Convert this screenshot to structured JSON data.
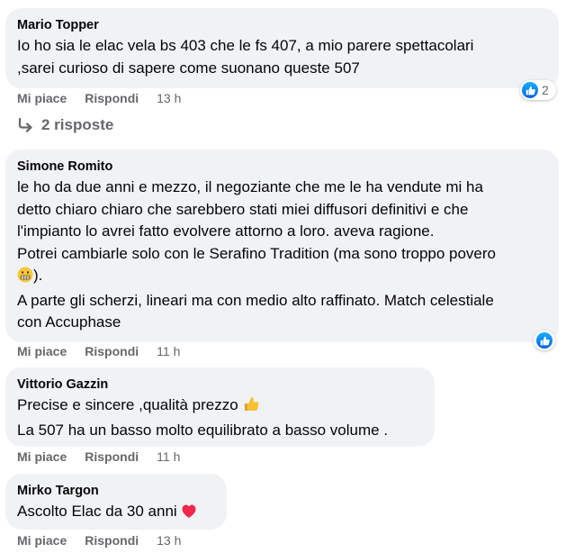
{
  "comments": [
    {
      "author": "Mario Topper",
      "lines": [
        "Io ho sia le elac vela bs 403 che le fs 407, a mio parere spettacolari",
        ",sarei curioso di sapere come suonano queste 507"
      ],
      "like_label": "Mi piace",
      "reply_label": "Rispondi",
      "time": "13 h",
      "reaction_count": "2"
    },
    {
      "author": "Simone Romito",
      "lines": [
        "le ho da due anni e mezzo, il negoziante che me le ha vendute mi ha",
        "detto chiaro chiaro che sarebbero stati miei diffusori definitivi e che",
        "l'impianto lo avrei fatto evolvere attorno a loro. aveva ragione.",
        "Potrei cambiarle solo con le Serafino Tradition (ma sono troppo povero",
        ").",
        "A parte gli scherzi, lineari ma con medio alto raffinato. Match celestiale",
        "con Accuphase"
      ],
      "like_label": "Mi piace",
      "reply_label": "Rispondi",
      "time": "11 h"
    },
    {
      "author": "Vittorio Gazzin",
      "lines": [
        "Precise e sincere ,qualità prezzo",
        "La 507 ha un basso molto equilibrato a basso volume ."
      ],
      "like_label": "Mi piace",
      "reply_label": "Rispondi",
      "time": "11 h"
    },
    {
      "author": "Mirko Targon",
      "lines": [
        "Ascolto Elac da 30 anni"
      ],
      "like_label": "Mi piace",
      "reply_label": "Rispondi",
      "time": "13 h"
    }
  ],
  "replies_link": "2 risposte",
  "icons": {
    "like_reaction": "thumbs-up-icon",
    "reply_arrow": "reply-arrow-icon",
    "grimace_emoji": "grimacing-face-icon",
    "thumbs_emoji": "thumbs-up-emoji-icon",
    "heart_emoji": "heart-icon"
  },
  "colors": {
    "bubble": "#f0f2f5",
    "meta_text": "#65676b",
    "like_blue": "#0866ff",
    "heart": "#f0284a"
  }
}
